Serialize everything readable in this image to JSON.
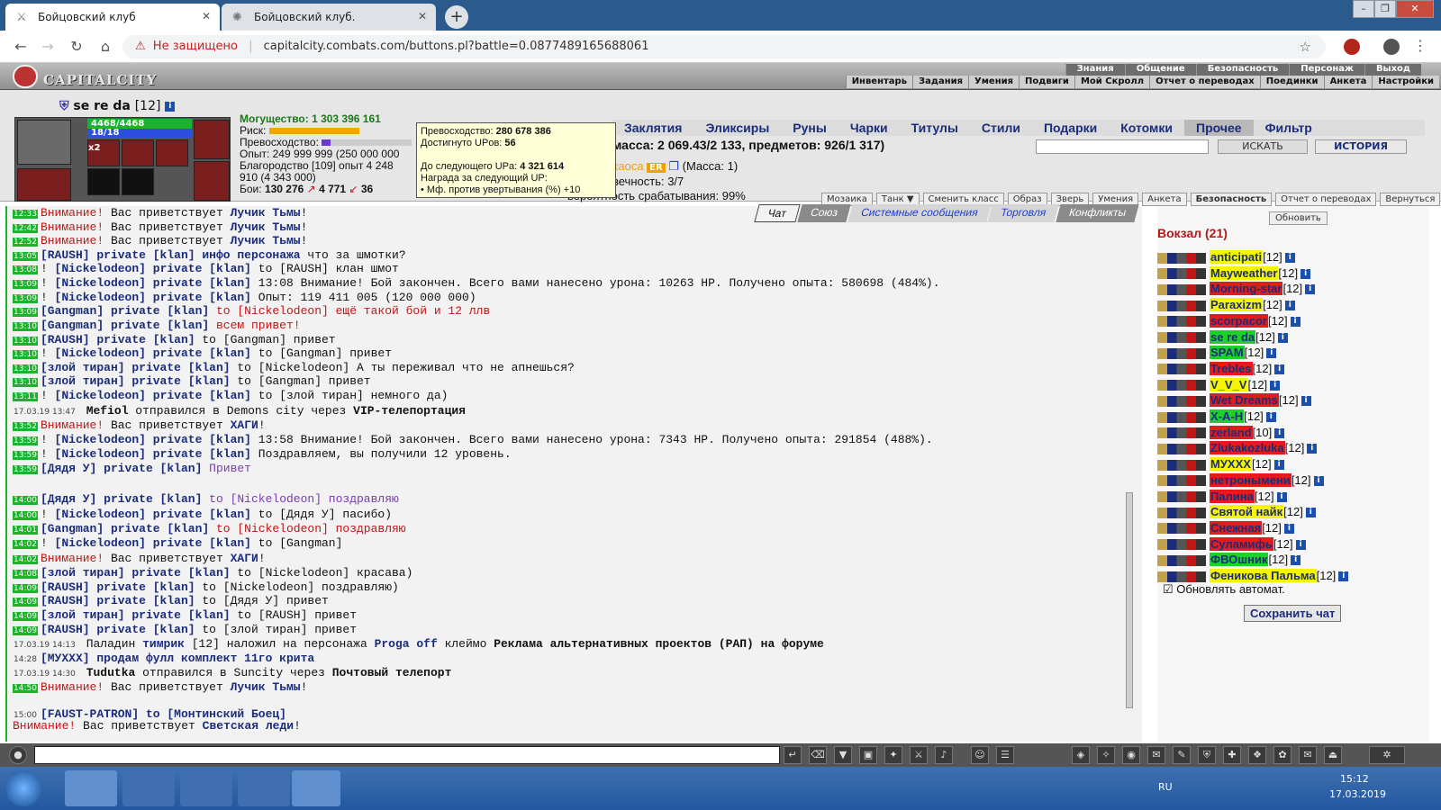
{
  "browser": {
    "tabs": [
      {
        "title": "Бойцовский клуб",
        "icon": "swords-icon"
      },
      {
        "title": "Бойцовский клуб.",
        "icon": "game-icon"
      }
    ],
    "security_label": "Не защищено",
    "url": "capitalcity.combats.com/buttons.pl?battle=0.0877489165688061"
  },
  "game": {
    "logo_text": "CAPITALCITY",
    "top_menu": [
      "Знания",
      "Общение",
      "Безопасность",
      "Персонаж",
      "Выход"
    ],
    "sub_menu": [
      "Инвентарь",
      "Задания",
      "Умения",
      "Подвиги",
      "Мой Скролл",
      "Отчет о переводах",
      "Поединки",
      "Анкета",
      "Настройки"
    ]
  },
  "character": {
    "name": "se re da",
    "level": "[12]",
    "hp": "4468/4468",
    "mana": "18/18",
    "slot_badge": "x2",
    "might": "Могущество: 1 303 396 161",
    "risk_label": "Риск:",
    "excellence_label": "Превосходство:",
    "exp": "Опыт: 249 999 999",
    "exp_next": "(250 000 000",
    "nobility": "Благородство [109] опыт 4 248",
    "nobility_next": "910 (4 343 000)",
    "battles_label": "Бои:",
    "battles_total": "130 276",
    "battles_wins": "4 771",
    "battles_draws": "36"
  },
  "tooltip": {
    "line1_label": "Превосходство:",
    "line1_value": "280 678 386",
    "line2_label": "Достигнуто UPов:",
    "line2_value": "56",
    "line3_label": "До следующего UPа:",
    "line3_value": "4 321 614",
    "line4": "Награда за следующий UP:",
    "line5": "• Мф. против увертывания (%) +10"
  },
  "inventory": {
    "buttons": [
      "Мозаика",
      "Танк ▼",
      "Сменить класс",
      "Образ",
      "Зверь",
      "Умения",
      "Анкета",
      "Безопасность",
      "Отчет о переводах",
      "Вернуться"
    ],
    "categories": [
      "Заклятия",
      "Эликсиры",
      "Руны",
      "Чарки",
      "Титулы",
      "Стили",
      "Подарки",
      "Котомки",
      "Прочее",
      "Фильтр"
    ],
    "active_category": "Прочее",
    "mass_line": "масса: 2 069.43/2 133, предметов: 926/1 317)",
    "search_button": "ИСКАТЬ",
    "history_button": "ИСТОРИЯ",
    "item_chaos": "хаоса",
    "item_er": "ER",
    "item_mass": "(Масса: 1)",
    "item_durability": "вечность: 3/7",
    "item_trigger": "вероятность срабатывания: 99%"
  },
  "chat": {
    "tabs": [
      "Чат",
      "Союз",
      "Системные сообщения",
      "Торговля",
      "Конфликты"
    ],
    "lines": [
      {
        "t": "12:33",
        "parts": [
          {
            "c": "warn",
            "v": "Внимание!"
          },
          {
            "c": "",
            "v": " Вас приветствует "
          },
          {
            "c": "bn",
            "v": "Лучик Тьмы"
          },
          {
            "c": "",
            "v": "!"
          }
        ]
      },
      {
        "t": "12:42",
        "parts": [
          {
            "c": "warn",
            "v": "Внимание!"
          },
          {
            "c": "",
            "v": " Вас приветствует "
          },
          {
            "c": "bn",
            "v": "Лучик Тьмы"
          },
          {
            "c": "",
            "v": "!"
          }
        ]
      },
      {
        "t": "12:52",
        "parts": [
          {
            "c": "warn",
            "v": "Внимание!"
          },
          {
            "c": "",
            "v": " Вас приветствует "
          },
          {
            "c": "bn",
            "v": "Лучик Тьмы"
          },
          {
            "c": "",
            "v": "!"
          }
        ]
      },
      {
        "t": "13:05",
        "parts": [
          {
            "c": "priv",
            "v": "[RAUSH] private [klan]"
          },
          {
            "c": "bn",
            "v": " инфо персонажа"
          },
          {
            "c": "",
            "v": " что за шмотки?"
          }
        ]
      },
      {
        "t": "13:08",
        "parts": [
          {
            "c": "",
            "v": "! "
          },
          {
            "c": "priv",
            "v": "[Nickelodeon] private [klan]"
          },
          {
            "c": "",
            "v": " to [RAUSH] клан шмот"
          }
        ]
      },
      {
        "t": "13:09",
        "parts": [
          {
            "c": "",
            "v": "! "
          },
          {
            "c": "priv",
            "v": "[Nickelodeon] private [klan]"
          },
          {
            "c": "",
            "v": " 13:08 Внимание! Бой закончен. Всего вами нанесено урона: 10263 HP. Получено опыта: 580698 (484%)."
          }
        ]
      },
      {
        "t": "13:09",
        "parts": [
          {
            "c": "",
            "v": "! "
          },
          {
            "c": "priv",
            "v": "[Nickelodeon] private [klan]"
          },
          {
            "c": "",
            "v": " Опыт: 119 411 005 (120 000 000)"
          }
        ]
      },
      {
        "t": "13:09",
        "parts": [
          {
            "c": "priv",
            "v": "[Gangman] private [klan]"
          },
          {
            "c": "warn",
            "v": " to [Nickelodeon] ещё такой бой и 12 ллв"
          }
        ]
      },
      {
        "t": "13:10",
        "parts": [
          {
            "c": "priv",
            "v": "[Gangman] private [klan]"
          },
          {
            "c": "warn",
            "v": " всем привет!"
          }
        ]
      },
      {
        "t": "13:10",
        "parts": [
          {
            "c": "priv",
            "v": "[RAUSH] private [klan]"
          },
          {
            "c": "",
            "v": " to [Gangman] привет"
          }
        ]
      },
      {
        "t": "13:10",
        "parts": [
          {
            "c": "",
            "v": "! "
          },
          {
            "c": "priv",
            "v": "[Nickelodeon] private [klan]"
          },
          {
            "c": "",
            "v": " to [Gangman] привет"
          }
        ]
      },
      {
        "t": "13:10",
        "parts": [
          {
            "c": "priv",
            "v": "[злой тиран] private [klan]"
          },
          {
            "c": "",
            "v": " to [Nickelodeon] А ты переживал что не апнешься?"
          }
        ]
      },
      {
        "t": "13:10",
        "parts": [
          {
            "c": "priv",
            "v": "[злой тиран] private [klan]"
          },
          {
            "c": "",
            "v": " to [Gangman] привет"
          }
        ]
      },
      {
        "t": "13:11",
        "parts": [
          {
            "c": "",
            "v": "! "
          },
          {
            "c": "priv",
            "v": "[Nickelodeon] private [klan]"
          },
          {
            "c": "",
            "v": " to [злой тиран] немного да)"
          }
        ]
      },
      {
        "t": "17.03.19 13:47",
        "plain": true,
        "parts": [
          {
            "c": "blk",
            "v": " Mefiol"
          },
          {
            "c": "",
            "v": " отправился в "
          },
          {
            "c": "",
            "v": "Demons city через "
          },
          {
            "c": "blk",
            "v": "VIP-телепортация"
          }
        ]
      },
      {
        "t": "13:52",
        "parts": [
          {
            "c": "warn",
            "v": "Внимание!"
          },
          {
            "c": "",
            "v": " Вас приветствует "
          },
          {
            "c": "bn",
            "v": "ХАГИ"
          },
          {
            "c": "",
            "v": "!"
          }
        ]
      },
      {
        "t": "13:59",
        "parts": [
          {
            "c": "",
            "v": "! "
          },
          {
            "c": "priv",
            "v": "[Nickelodeon] private [klan]"
          },
          {
            "c": "",
            "v": " 13:58 Внимание! Бой закончен. Всего вами нанесено урона: 7343 HP. Получено опыта: 291854 (488%)."
          }
        ]
      },
      {
        "t": "13:59",
        "parts": [
          {
            "c": "",
            "v": "! "
          },
          {
            "c": "priv",
            "v": "[Nickelodeon] private [klan]"
          },
          {
            "c": "",
            "v": " Поздравляем, вы получили 12 уровень."
          }
        ]
      },
      {
        "t": "13:59",
        "parts": [
          {
            "c": "priv",
            "v": "[Дядя У] private [klan]"
          },
          {
            "c": "pur",
            "v": " Привет"
          }
        ]
      },
      {
        "t": "14:00",
        "parts": [
          {
            "c": "priv",
            "v": "[Дядя У] private [klan]"
          },
          {
            "c": "pur",
            "v": " to [Nickelodeon]"
          },
          {
            "c": "pur",
            "v": "                           поздравляю"
          }
        ]
      },
      {
        "t": "14:00",
        "parts": [
          {
            "c": "",
            "v": "! "
          },
          {
            "c": "priv",
            "v": "[Nickelodeon] private [klan]"
          },
          {
            "c": "",
            "v": " to [Дядя У] пасибо)"
          }
        ]
      },
      {
        "t": "14:01",
        "parts": [
          {
            "c": "priv",
            "v": "[Gangman] private [klan]"
          },
          {
            "c": "warn",
            "v": " to [Nickelodeon] поздравляю"
          }
        ]
      },
      {
        "t": "14:02",
        "parts": [
          {
            "c": "",
            "v": "! "
          },
          {
            "c": "priv",
            "v": "[Nickelodeon] private [klan]"
          },
          {
            "c": "",
            "v": " to [Gangman] "
          }
        ]
      },
      {
        "t": "14:02",
        "parts": [
          {
            "c": "warn",
            "v": "Внимание!"
          },
          {
            "c": "",
            "v": " Вас приветствует "
          },
          {
            "c": "bn",
            "v": "ХАГИ"
          },
          {
            "c": "",
            "v": "!"
          }
        ]
      },
      {
        "t": "14:08",
        "parts": [
          {
            "c": "priv",
            "v": "[злой тиран] private [klan]"
          },
          {
            "c": "",
            "v": " to [Nickelodeon] красава)"
          }
        ]
      },
      {
        "t": "14:09",
        "parts": [
          {
            "c": "priv",
            "v": "[RAUSH] private [klan]"
          },
          {
            "c": "",
            "v": " to [Nickelodeon] поздравляю)"
          }
        ]
      },
      {
        "t": "14:09",
        "parts": [
          {
            "c": "priv",
            "v": "[RAUSH] private [klan]"
          },
          {
            "c": "",
            "v": " to [Дядя У] привет"
          }
        ]
      },
      {
        "t": "14:09",
        "parts": [
          {
            "c": "priv",
            "v": "[злой тиран] private [klan]"
          },
          {
            "c": "",
            "v": " to [RAUSH] привет"
          }
        ]
      },
      {
        "t": "14:09",
        "parts": [
          {
            "c": "priv",
            "v": "[RAUSH] private [klan]"
          },
          {
            "c": "",
            "v": " to [злой тиран] привет"
          }
        ]
      },
      {
        "t": "17.03.19 14:13",
        "plain": true,
        "parts": [
          {
            "c": "",
            "v": " Паладин "
          },
          {
            "c": "bn",
            "v": "тимрик"
          },
          {
            "c": "",
            "v": " [12] наложил на персонажа "
          },
          {
            "c": "bn",
            "v": "Proga off"
          },
          {
            "c": "",
            "v": " клеймо "
          },
          {
            "c": "blk",
            "v": "Реклама альтернативных проектов (РАП) на форуме"
          }
        ]
      },
      {
        "t": "14:28",
        "plain": true,
        "parts": [
          {
            "c": "priv",
            "v": "[МУХХХ]"
          },
          {
            "c": "bn",
            "v": " продам фулл комплект 11го крита"
          }
        ]
      },
      {
        "t": "17.03.19 14:30",
        "plain": true,
        "parts": [
          {
            "c": "blk",
            "v": " Tudutka"
          },
          {
            "c": "",
            "v": " отправился в "
          },
          {
            "c": "",
            "v": "Suncity через "
          },
          {
            "c": "blk",
            "v": "Почтовый телепорт"
          }
        ]
      },
      {
        "t": "14:50",
        "parts": [
          {
            "c": "warn",
            "v": "Внимание!"
          },
          {
            "c": "",
            "v": " Вас приветствует "
          },
          {
            "c": "bn",
            "v": "Лучик Тьмы"
          },
          {
            "c": "",
            "v": "!"
          }
        ]
      },
      {
        "t": "15:00",
        "plain": true,
        "parts": [
          {
            "c": "priv",
            "v": "[FAUST-PATRON]"
          },
          {
            "c": "bn",
            "v": " to [Монтинский Боец]"
          }
        ]
      },
      {
        "t": "",
        "plain": true,
        "parts": [
          {
            "c": "warn",
            "v": "Внимание!"
          },
          {
            "c": "",
            "v": " Вас приветствует "
          },
          {
            "c": "bn",
            "v": "Светская леди"
          },
          {
            "c": "",
            "v": "!"
          }
        ]
      }
    ]
  },
  "room": {
    "refresh_label": "Обновить",
    "title": "Вокзал (21)",
    "users": [
      {
        "name": "anticipati",
        "lvl": "[12]",
        "bg": "#f5f500"
      },
      {
        "name": "Mayweather",
        "lvl": "[12]",
        "bg": "#f5f500"
      },
      {
        "name": "Morning-star",
        "lvl": "[12]",
        "bg": "#e31b1b"
      },
      {
        "name": "Paraxizm",
        "lvl": "[12]",
        "bg": "#f5f500"
      },
      {
        "name": "scorpacor",
        "lvl": "[12]",
        "bg": "#e31b1b"
      },
      {
        "name": "se re da",
        "lvl": "[12]",
        "bg": "#1bd12a"
      },
      {
        "name": "SPAM",
        "lvl": "[12]",
        "bg": "#1bd12a"
      },
      {
        "name": "Trebles",
        "lvl": "[12]",
        "bg": "#e31b1b"
      },
      {
        "name": "V_V_V",
        "lvl": "[12]",
        "bg": "#f5f500"
      },
      {
        "name": "Wet Dreams",
        "lvl": "[12]",
        "bg": "#e31b1b"
      },
      {
        "name": "X-A-H",
        "lvl": "[12]",
        "bg": "#1bd12a"
      },
      {
        "name": "zerland",
        "lvl": "[10]",
        "bg": "#e31b1b"
      },
      {
        "name": "Zlukakozluka",
        "lvl": "[12]",
        "bg": "#e31b1b"
      },
      {
        "name": "МУХХХ",
        "lvl": "[12]",
        "bg": "#f5f500"
      },
      {
        "name": "нетронымени",
        "lvl": "[12]",
        "bg": "#e31b1b"
      },
      {
        "name": "Палина",
        "lvl": "[12]",
        "bg": "#e31b1b"
      },
      {
        "name": "Святой найк",
        "lvl": "[12]",
        "bg": "#f5f500"
      },
      {
        "name": "Снежная",
        "lvl": "[12]",
        "bg": "#e31b1b"
      },
      {
        "name": "Суламифь",
        "lvl": "[12]",
        "bg": "#e31b1b"
      },
      {
        "name": "ФВОшник",
        "lvl": "[12]",
        "bg": "#1bd12a"
      },
      {
        "name": "Феникова Пальма",
        "lvl": "[12]",
        "bg": "#f5f500"
      }
    ],
    "auto_refresh_label": "Обновлять автомат.",
    "save_chat_label": "Сохранить чат"
  },
  "taskbar": {
    "lang": "RU",
    "time": "15:12",
    "date": "17.03.2019"
  }
}
